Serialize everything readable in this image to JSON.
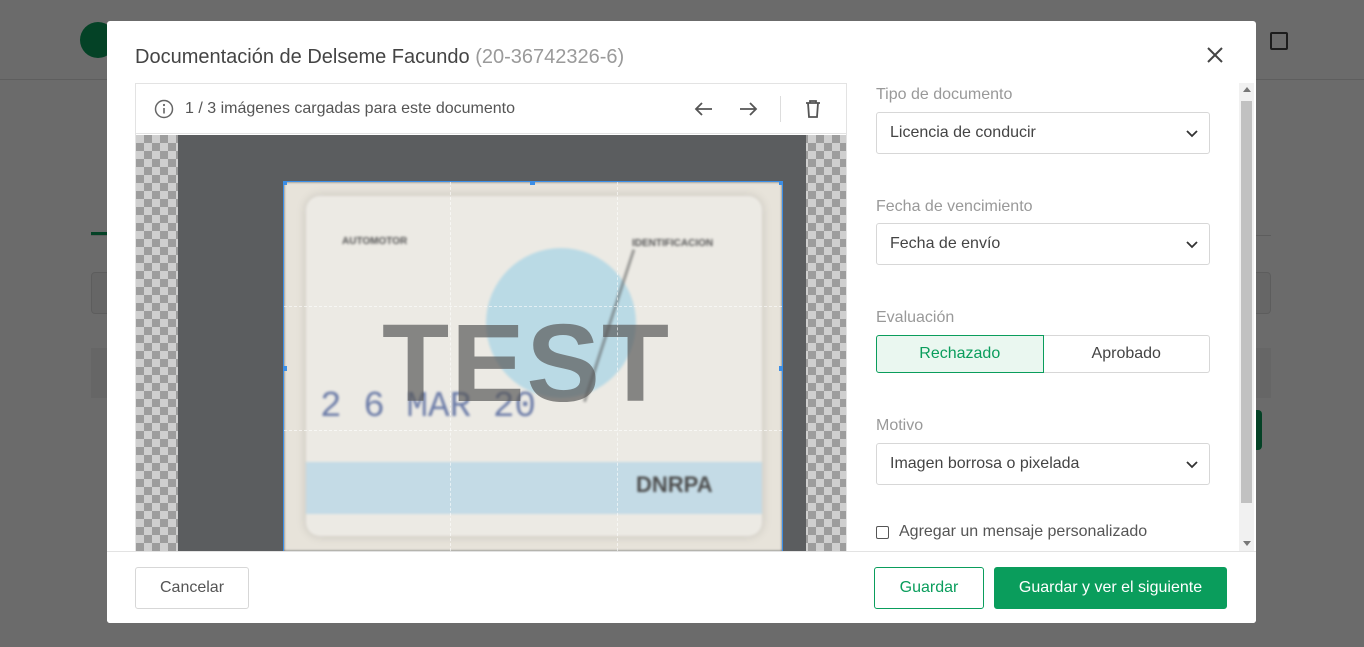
{
  "modal": {
    "title": "Documentación de Delseme Facundo",
    "cuit": "(20-36742326-6)"
  },
  "viewer": {
    "image_count": "1 / 3 imágenes cargadas para este documento",
    "watermark": "TEST",
    "license": {
      "header_left": "AUTOMOTOR",
      "header_right": "IDENTIFICACION",
      "date": "2 6 MAR 20",
      "brand": "DNRPA"
    }
  },
  "form": {
    "tipo_label": "Tipo de documento",
    "tipo_value": "Licencia de conducir",
    "fecha_label": "Fecha de vencimiento",
    "fecha_value": "Fecha de envío",
    "evaluacion_label": "Evaluación",
    "evaluacion_options": [
      "Rechazado",
      "Aprobado"
    ],
    "evaluacion_selected": "Rechazado",
    "motivo_label": "Motivo",
    "motivo_value": "Imagen borrosa o pixelada",
    "custom_message_label": "Agregar un mensaje personalizado",
    "custom_message_checked": false
  },
  "footer": {
    "cancel_label": "Cancelar",
    "save_label": "Guardar",
    "save_next_label": "Guardar y ver el siguiente"
  },
  "colors": {
    "accent": "#0a9d5c",
    "crop_border": "#3b8ee6"
  }
}
